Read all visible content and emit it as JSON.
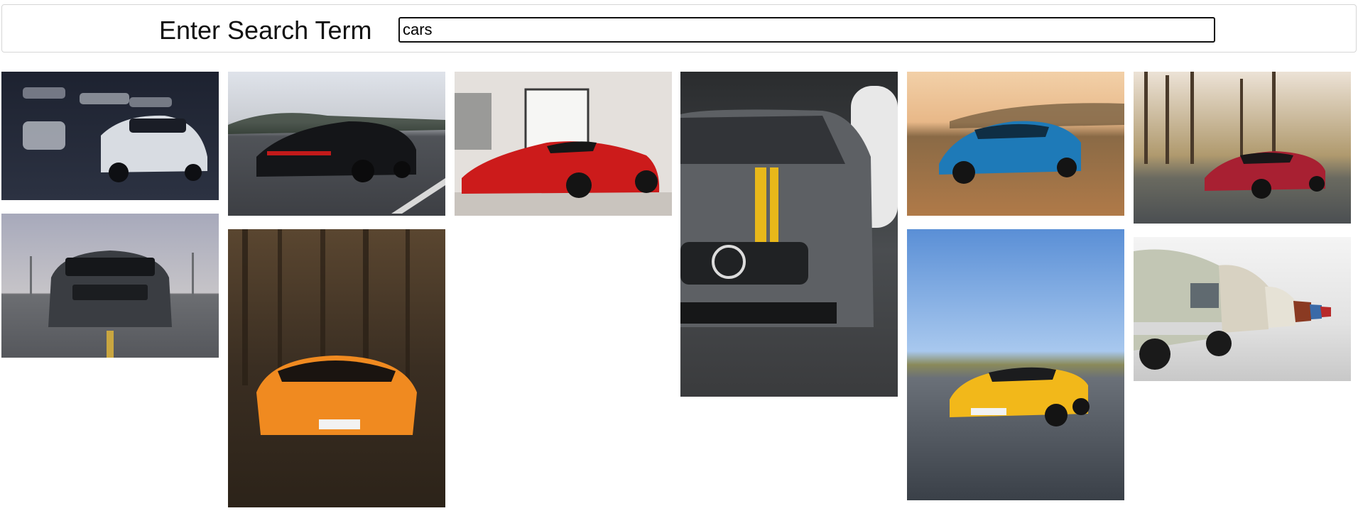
{
  "search": {
    "label": "Enter Search Term",
    "value": "cars"
  },
  "gallery": {
    "images": [
      {
        "name": "white-camaro-garage-image",
        "bg_top": "#1d2230",
        "bg_bottom": "#2c3242",
        "car": "#d8dce2"
      },
      {
        "name": "gray-mustang-road-image",
        "bg_top": "#9ea3ae",
        "bg_bottom": "#5a5d63",
        "car": "#3a3d42"
      },
      {
        "name": "black-porsche-road-image",
        "bg_top": "#dfe3ea",
        "bg_bottom": "#505358",
        "car": "#141518"
      },
      {
        "name": "orange-lamborghini-forest-image",
        "bg_top": "#4a3a2a",
        "bg_bottom": "#2c2319",
        "car": "#f08a20"
      },
      {
        "name": "red-ferrari-showroom-image",
        "bg_top": "#e8e4e0",
        "bg_bottom": "#cfcac4",
        "car": "#cc1b1b"
      },
      {
        "name": "gray-mercedes-yellow-stripe-image",
        "bg_top": "#3a3d40",
        "bg_bottom": "#505356",
        "car": "#5d6064"
      },
      {
        "name": "blue-camaro-desert-image",
        "bg_top": "#e8b888",
        "bg_bottom": "#b07a48",
        "car": "#1e7ab8"
      },
      {
        "name": "yellow-mercedes-amg-road-image",
        "bg_top": "#78a8e0",
        "bg_bottom": "#4a5560",
        "car": "#f2b81a"
      },
      {
        "name": "red-mercedes-amg-forest-image",
        "bg_top": "#d6cbc0",
        "bg_bottom": "#4b4f52",
        "car": "#a82032"
      },
      {
        "name": "vintage-bmw-row-image",
        "bg_top": "#eeeeee",
        "bg_bottom": "#c8c8c8",
        "car": "#c2c6b4"
      }
    ]
  }
}
